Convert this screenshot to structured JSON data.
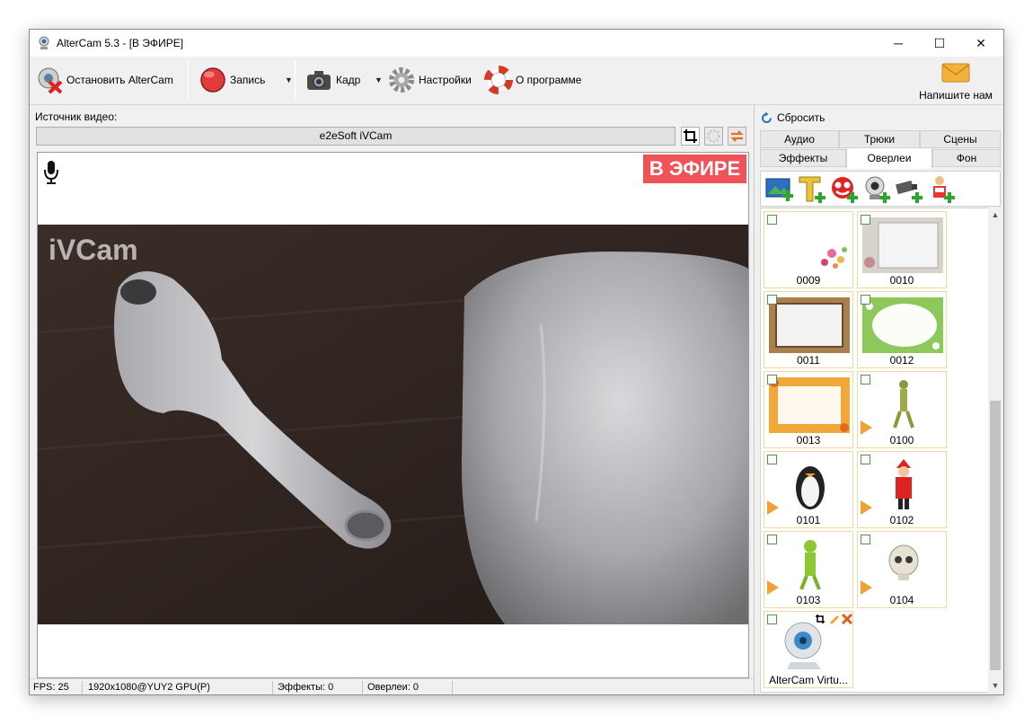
{
  "window": {
    "title": "AlterCam 5.3 - [В ЭФИРЕ]",
    "minimize": "─",
    "maximize": "☐",
    "close": "✕"
  },
  "toolbar": {
    "stop_label": "Остановить AlterCam",
    "record_label": "Запись",
    "frame_label": "Кадр",
    "settings_label": "Настройки",
    "about_label": "О программе",
    "mail_label": "Напишите нам",
    "dropdown_glyph": "▼"
  },
  "source": {
    "label": "Источник видео:",
    "value": "e2eSoft iVCam"
  },
  "preview": {
    "onair_badge": "В ЭФИРЕ",
    "watermark": "iVCam"
  },
  "statusbar": {
    "fps": "FPS: 25",
    "resolution": "1920x1080@YUY2 GPU(P)",
    "effects": "Эффекты: 0",
    "overlays": "Оверлеи: 0"
  },
  "right_panel": {
    "reset_label": "Сбросить",
    "tabs_row1": [
      "Аудио",
      "Трюки",
      "Сцены"
    ],
    "tabs_row2": [
      "Эффекты",
      "Оверлеи",
      "Фон"
    ],
    "active_tab": "Оверлеи",
    "overlays": [
      {
        "label": "0009",
        "animated": false
      },
      {
        "label": "0010",
        "animated": false
      },
      {
        "label": "0011",
        "animated": false
      },
      {
        "label": "0012",
        "animated": false
      },
      {
        "label": "0013",
        "animated": false
      },
      {
        "label": "0100",
        "animated": true
      },
      {
        "label": "0101",
        "animated": true
      },
      {
        "label": "0102",
        "animated": true
      },
      {
        "label": "0103",
        "animated": true
      },
      {
        "label": "0104",
        "animated": true
      },
      {
        "label": "AlterCam Virtu...",
        "animated": false
      }
    ]
  },
  "colors": {
    "onair": "#ef5358",
    "tile_border": "#f1d9a4",
    "play_arrow": "#f0a23a"
  }
}
